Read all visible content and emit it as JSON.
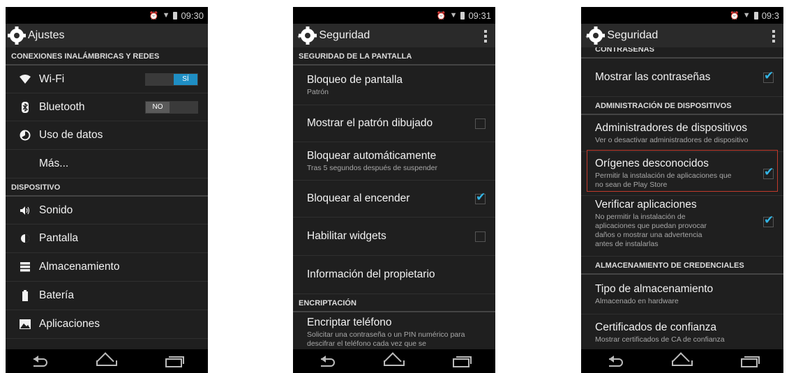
{
  "colors": {
    "accent": "#33b5e5",
    "toggle_on": "#1e8ec4",
    "highlight": "#c0392b"
  },
  "screen1": {
    "status_time": "09:30",
    "title": "Ajustes",
    "sections": [
      {
        "header": "CONEXIONES INALÁMBRICAS Y REDES"
      },
      {
        "header": "DISPOSITIVO"
      }
    ],
    "wifi": {
      "label": "Wi-Fi",
      "toggle": "SÍ",
      "icon": "wifi-icon"
    },
    "bluetooth": {
      "label": "Bluetooth",
      "toggle": "NO",
      "icon": "bluetooth-icon"
    },
    "data_usage": {
      "label": "Uso de datos",
      "icon": "data-usage-icon"
    },
    "more": {
      "label": "Más..."
    },
    "sound": {
      "label": "Sonido",
      "icon": "sound-icon"
    },
    "display": {
      "label": "Pantalla",
      "icon": "display-icon"
    },
    "storage": {
      "label": "Almacenamiento",
      "icon": "storage-icon"
    },
    "battery": {
      "label": "Batería",
      "icon": "battery-icon"
    },
    "apps": {
      "label": "Aplicaciones",
      "icon": "apps-icon"
    }
  },
  "screen2": {
    "status_time": "09:31",
    "title": "Seguridad",
    "header_screen": "SEGURIDAD DE LA PANTALLA",
    "screen_lock": {
      "title": "Bloqueo de pantalla",
      "sub": "Patrón"
    },
    "show_pattern": {
      "title": "Mostrar el patrón dibujado",
      "checked": false
    },
    "auto_lock": {
      "title": "Bloquear automáticamente",
      "sub": "Tras 5 segundos después de suspender"
    },
    "power_lock": {
      "title": "Bloquear al encender",
      "checked": true
    },
    "widgets": {
      "title": "Habilitar widgets",
      "checked": false
    },
    "owner_info": {
      "title": "Información del propietario"
    },
    "header_encrypt": "ENCRIPTACIÓN",
    "encrypt": {
      "title": "Encriptar teléfono",
      "sub": "Solicitar una contraseña o un PIN numérico para descifrar el teléfono cada vez que se"
    }
  },
  "screen3": {
    "status_time": "09:3",
    "title": "Seguridad",
    "header_passwords": "CONTRASEÑAS",
    "show_passwords": {
      "title": "Mostrar las contraseñas",
      "checked": true
    },
    "header_admin": "ADMINISTRACIÓN DE DISPOSITIVOS",
    "device_admins": {
      "title": "Administradores de dispositivos",
      "sub": "Ver o desactivar administradores de dispositivo"
    },
    "unknown_sources": {
      "title": "Orígenes desconocidos",
      "sub": "Permitir la instalación de aplicaciones que no sean de Play Store",
      "checked": true
    },
    "verify_apps": {
      "title": "Verificar aplicaciones",
      "sub": "No permitir la instalación de aplicaciones que puedan provocar daños o mostrar una advertencia antes de instalarlas",
      "checked": true
    },
    "header_creds": "ALMACENAMIENTO DE CREDENCIALES",
    "storage_type": {
      "title": "Tipo de almacenamiento",
      "sub": "Almacenado en hardware"
    },
    "trusted_certs": {
      "title": "Certificados de confianza",
      "sub": "Mostrar certificados de CA de confianza"
    }
  }
}
